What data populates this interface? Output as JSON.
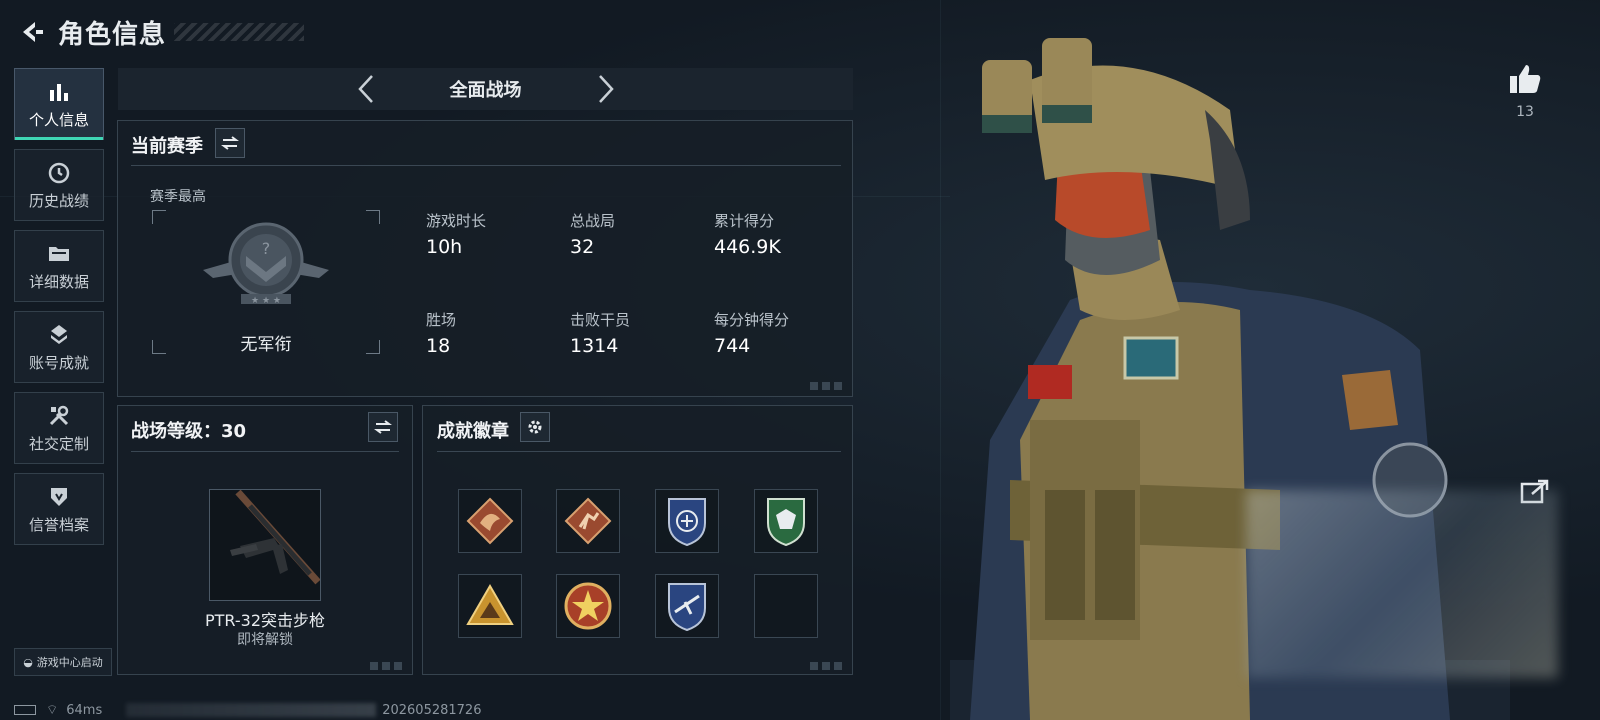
{
  "header": {
    "title": "角色信息"
  },
  "sidebar": {
    "items": [
      {
        "label": "个人信息",
        "icon": "bar-chart-icon",
        "active": true
      },
      {
        "label": "历史战绩",
        "icon": "history-icon",
        "active": false
      },
      {
        "label": "详细数据",
        "icon": "folder-icon",
        "active": false
      },
      {
        "label": "账号成就",
        "icon": "achievement-icon",
        "active": false
      },
      {
        "label": "社交定制",
        "icon": "tools-icon",
        "active": false
      },
      {
        "label": "信誉档案",
        "icon": "credit-icon",
        "active": false
      }
    ],
    "launch_label": "游戏中心启动"
  },
  "mode": {
    "title": "全面战场"
  },
  "season": {
    "title": "当前赛季",
    "best_label": "赛季最高",
    "rank_name": "无军衔",
    "stats": [
      {
        "label": "游戏时长",
        "value": "10h"
      },
      {
        "label": "总战局",
        "value": "32"
      },
      {
        "label": "累计得分",
        "value": "446.9K"
      },
      {
        "label": "胜场",
        "value": "18"
      },
      {
        "label": "击败干员",
        "value": "1314"
      },
      {
        "label": "每分钟得分",
        "value": "744"
      }
    ]
  },
  "battle_level": {
    "title": "战场等级：30",
    "weapon_name": "PTR-32突击步枪",
    "weapon_status": "即将解锁"
  },
  "badges": {
    "title": "成就徽章",
    "items": [
      {
        "icon": "dragon-badge-icon",
        "color": "#b0583a"
      },
      {
        "icon": "runner-badge-icon",
        "color": "#b0583a"
      },
      {
        "icon": "shield-blue-badge-icon",
        "color": "#2f4d8a"
      },
      {
        "icon": "shield-green-badge-icon",
        "color": "#2f7a4a"
      },
      {
        "icon": "triangle-badge-icon",
        "color": "#c8932e"
      },
      {
        "icon": "star-badge-icon",
        "color": "#b54a2e"
      },
      {
        "icon": "shield-plane-badge-icon",
        "color": "#2f4d8a"
      },
      {
        "icon": "empty-slot",
        "color": ""
      }
    ]
  },
  "social": {
    "likes": "13"
  },
  "status": {
    "ping": "64ms",
    "build": "202605281726"
  },
  "colors": {
    "accent": "#3fd6b5",
    "background": "#121a23",
    "panel_border": "#36434e"
  }
}
